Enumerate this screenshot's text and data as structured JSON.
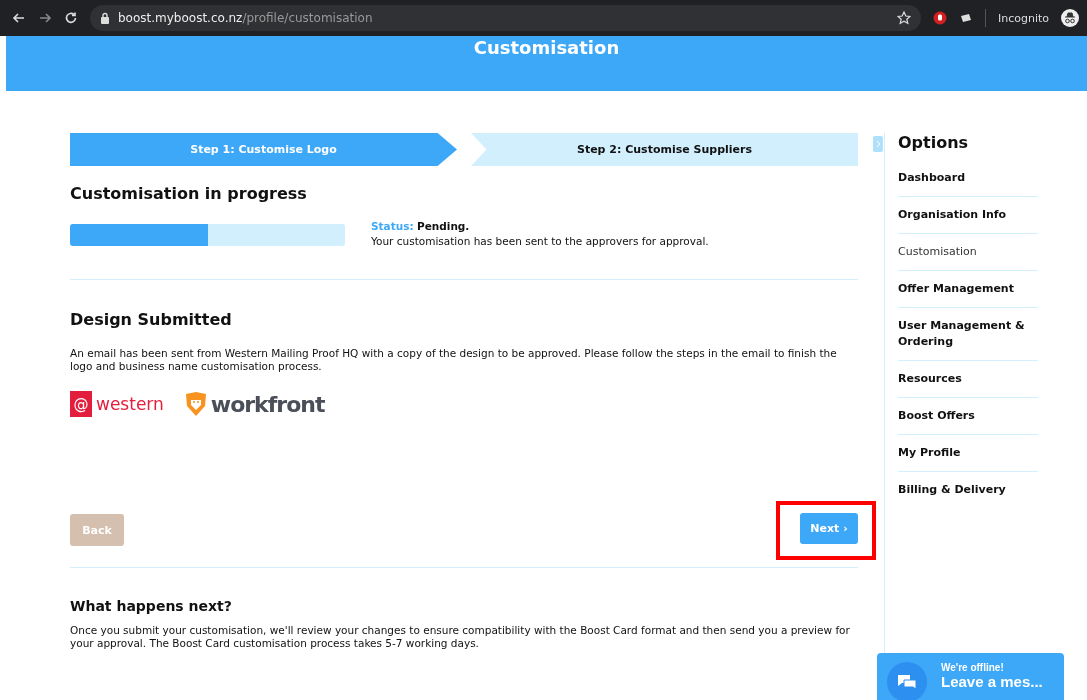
{
  "browser": {
    "url_host": "boost.myboost.co.nz",
    "url_path": "/profile/customisation",
    "profile": "Incognito"
  },
  "header": {
    "title": "Customisation"
  },
  "steps": [
    {
      "label": "Step 1: Customise Logo",
      "selected": true
    },
    {
      "label": "Step 2: Customise Suppliers",
      "selected": false
    }
  ],
  "progress": {
    "heading": "Customisation in progress",
    "level": 0.5,
    "status_label": "Status:",
    "status_value": "Pending.",
    "message": "Your customisation has been sent to the approvers for approval."
  },
  "design": {
    "heading": "Design Submitted",
    "text": "An email has been sent from Western Mailing Proof HQ with a copy of the design to be approved. Please follow the steps in the email to finish the logo and business name customisation process.",
    "logos": [
      {
        "kind": "western",
        "mark": "@",
        "name": "western"
      },
      {
        "kind": "workfront",
        "name": "workfront"
      }
    ]
  },
  "buttons": {
    "back": "Back",
    "next": "Next ›",
    "next_highlighted": true
  },
  "next_info": {
    "heading": "What happens next?",
    "text": "Once you submit your customisation, we'll review your changes to ensure compatibility with the Boost Card format and then send you a preview for your approval. The Boost Card customisation process takes 5-7 working days."
  },
  "sidebar": {
    "title": "Options",
    "items": [
      {
        "label": "Dashboard",
        "selected": false
      },
      {
        "label": "Organisation Info",
        "selected": false
      },
      {
        "label": "Customisation",
        "selected": true
      },
      {
        "label": "Offer Management",
        "selected": false
      },
      {
        "label": "User Management & Ordering",
        "selected": false
      },
      {
        "label": "Resources",
        "selected": false
      },
      {
        "label": "Boost Offers",
        "selected": false
      },
      {
        "label": "My Profile",
        "selected": false
      },
      {
        "label": "Billing & Delivery",
        "selected": false
      }
    ]
  },
  "chat": {
    "status": "We're offline!",
    "action": "Leave a mes..."
  }
}
